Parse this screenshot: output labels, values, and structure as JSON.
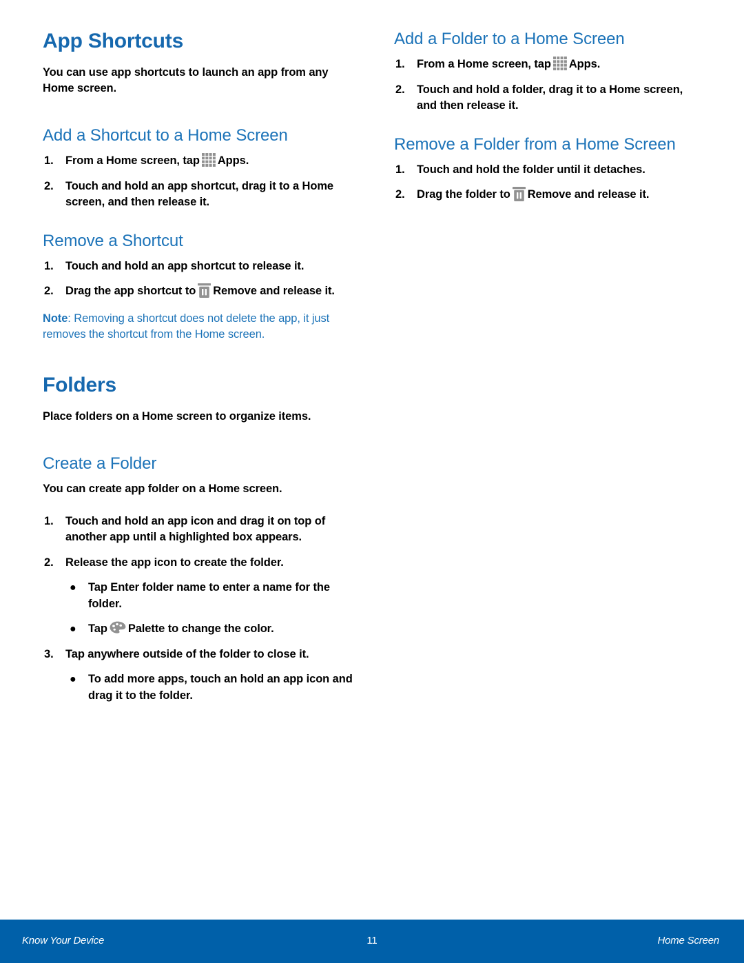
{
  "document": {
    "page_number": "11",
    "footer": {
      "left": "Know Your Device",
      "center": "11",
      "right": "Home Screen"
    },
    "colors": {
      "heading_primary": "#1668ae",
      "heading_secondary": "#1c73b8",
      "note_text": "#1c73b8",
      "footer_bar": "#0060a9",
      "icon_gray": "#919191",
      "body_text": "#000000"
    }
  },
  "left_column": {
    "section_app_shortcuts": {
      "title": "App Shortcuts",
      "intro": "You can use app shortcuts to launch an app from any Home screen.",
      "sub_add": {
        "title": "Add a Shortcut to a Home Screen",
        "steps": [
          {
            "num": "1.",
            "text_before": "From a Home screen, tap",
            "icon": "apps-grid-icon",
            "text_after": "Apps."
          },
          {
            "num": "2.",
            "text_before": "Touch and hold an app shortcut, drag it to a Home screen, and then release it.",
            "icon": "",
            "text_after": ""
          }
        ]
      },
      "sub_remove": {
        "title": "Remove a Shortcut",
        "steps": [
          {
            "num": "1.",
            "text_before": "Touch and hold an app shortcut to release it.",
            "icon": "",
            "text_after": ""
          },
          {
            "num": "2.",
            "text_before": "Drag the app shortcut to",
            "icon": "trash-remove-icon",
            "bold_after": "Remove",
            "text_after": "and release it."
          }
        ],
        "note_label": "Note",
        "note_text": ": Removing a shortcut does not delete the app, it just removes the shortcut from the Home screen."
      }
    },
    "section_folders": {
      "title": "Folders",
      "intro": "Place folders on a Home screen to organize items.",
      "sub_create": {
        "title": "Create a Folder",
        "intro": "You can create app folder on a Home screen.",
        "step1": {
          "num": "1.",
          "text": "Touch and hold an app icon and drag it on top of another app until a highlighted box appears."
        },
        "step2": {
          "num": "2.",
          "text": "Release the app icon to create the folder."
        },
        "bullet_enter_name": {
          "text_before": "Tap",
          "bold": "Enter folder name",
          "text_after": "to enter a name for the folder."
        },
        "bullet_palette": {
          "text_before": "Tap",
          "icon": "palette-icon",
          "bold": "Palette",
          "text_after": "to change the color."
        },
        "step3": {
          "num": "3.",
          "text": "Tap anywhere outside of the folder to close it."
        },
        "bullet_add_more": {
          "text": "To add more apps, touch an hold an app icon and drag it to the folder."
        }
      }
    }
  },
  "right_column": {
    "sub_add_folder": {
      "title": "Add a Folder to a Home Screen",
      "step1": {
        "num": "1.",
        "text_before": "From a Home screen, tap",
        "icon": "apps-grid-icon",
        "text_after": "Apps."
      },
      "step2": {
        "num": "2.",
        "text": "Touch and hold a folder, drag it to a Home screen, and then release it."
      }
    },
    "sub_remove_folder": {
      "title": "Remove a Folder from a Home Screen",
      "step1": {
        "num": "1.",
        "text": "Touch and hold the folder until it detaches."
      },
      "step2": {
        "num": "2.",
        "text_before": "Drag the folder to",
        "icon": "trash-remove-icon",
        "bold": "Remove",
        "text_after": "and release it."
      }
    }
  }
}
